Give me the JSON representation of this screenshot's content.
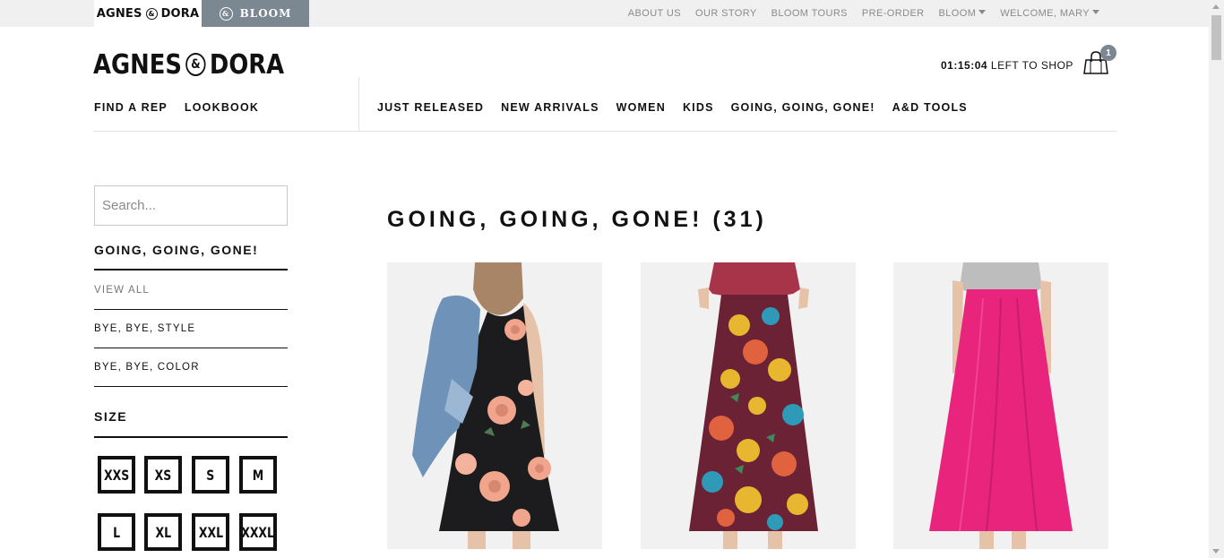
{
  "topbar": {
    "brand_tab": {
      "left_word": "AGNES",
      "amp": "&",
      "right_word": "DORA"
    },
    "bloom_tab": {
      "label": "BLOOM"
    },
    "links": [
      "ABOUT US",
      "OUR STORY",
      "BLOOM TOURS",
      "PRE-ORDER"
    ],
    "bloom_dropdown": "BLOOM",
    "welcome": "WELCOME, MARY"
  },
  "header": {
    "logo": {
      "left_word": "AGNES",
      "amp": "&",
      "right_word": "DORA"
    },
    "timer": {
      "time": "01:15:04",
      "text": "LEFT TO SHOP"
    },
    "cart_count": "1",
    "nav_left": [
      "FIND A REP",
      "LOOKBOOK"
    ],
    "nav_main": [
      "JUST RELEASED",
      "NEW ARRIVALS",
      "WOMEN",
      "KIDS",
      "GOING, GOING, GONE!",
      "A&D TOOLS"
    ]
  },
  "sidebar": {
    "search_placeholder": "Search...",
    "category_title": "GOING, GOING, GONE!",
    "links": [
      "VIEW ALL",
      "BYE, BYE, STYLE",
      "BYE, BYE, COLOR"
    ],
    "size_title": "SIZE",
    "sizes": [
      "XXS",
      "XS",
      "S",
      "M",
      "L",
      "XL",
      "XXL",
      "XXXL"
    ]
  },
  "main": {
    "title": "GOING, GOING, GONE! (31)"
  },
  "colors": {
    "bloom_tab": "#7c8891",
    "dress_black": "#1c1c1e",
    "floral_peach": "#f0a58c",
    "skirt_pink": "#e8247c",
    "top_maroon": "#a8344a",
    "top_gray": "#bdbdbd"
  }
}
